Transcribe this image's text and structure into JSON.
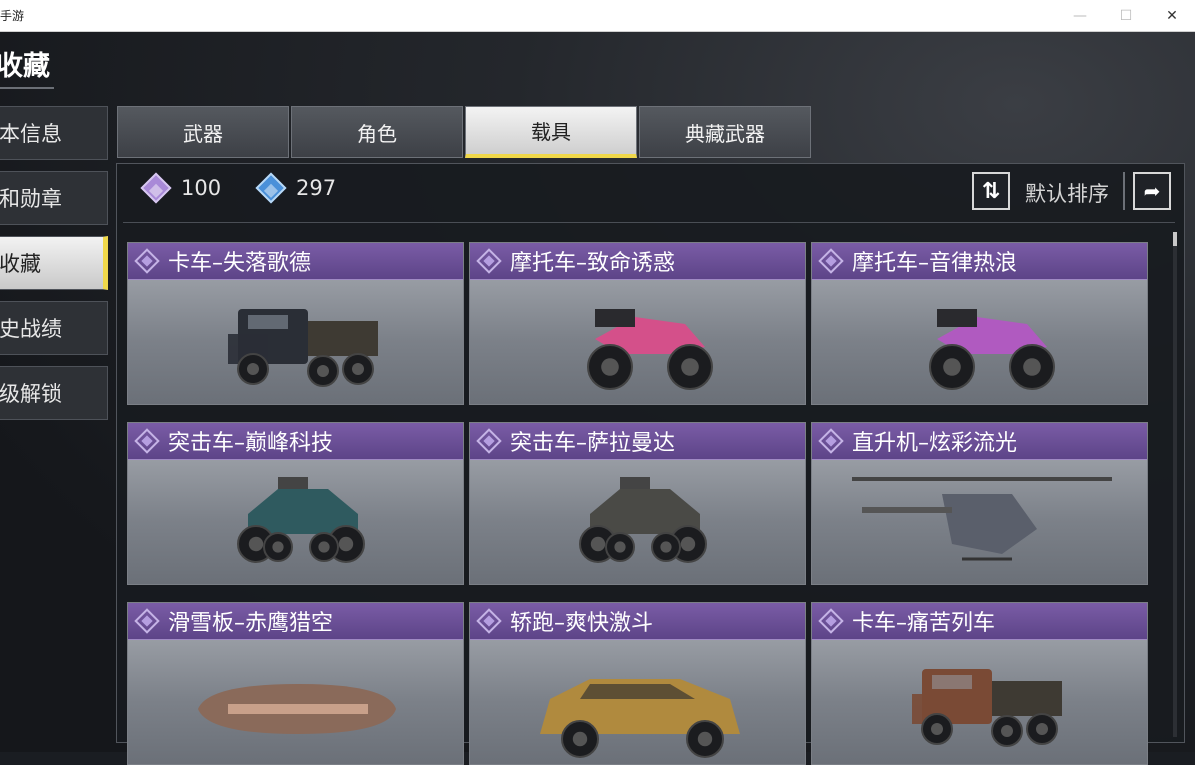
{
  "window": {
    "title": "手游",
    "minimize": "—",
    "maximize": "☐",
    "close": "✕"
  },
  "header": {
    "title": "收藏"
  },
  "sidebar": {
    "items": [
      {
        "label": "基本信息",
        "active": false
      },
      {
        "label": "徽章和勋章",
        "active": false
      },
      {
        "label": "收藏",
        "active": true
      },
      {
        "label": "历史战绩",
        "active": false
      },
      {
        "label": "等级解锁",
        "active": false
      }
    ]
  },
  "tabs": [
    {
      "label": "武器",
      "active": false
    },
    {
      "label": "角色",
      "active": false
    },
    {
      "label": "载具",
      "active": true
    },
    {
      "label": "典藏武器",
      "active": false
    }
  ],
  "currency": {
    "purple": "100",
    "blue": "297"
  },
  "sort": {
    "icon": "swap-vertical-icon",
    "label": "默认排序",
    "share_icon": "share-icon"
  },
  "colors": {
    "accent": "#f0d84a",
    "card_header": "#6a4f96",
    "gem_purple": "#a98ad8",
    "gem_blue": "#4a90d9"
  },
  "cards": [
    {
      "name": "卡车–失落歌德",
      "kind": "truck",
      "tone": "#2a2e36"
    },
    {
      "name": "摩托车–致命诱惑",
      "kind": "moto",
      "tone": "#d4508a"
    },
    {
      "name": "摩托车–音律热浪",
      "kind": "moto",
      "tone": "#b05ac0"
    },
    {
      "name": "突击车–巅峰科技",
      "kind": "buggy",
      "tone": "#2f5a5f"
    },
    {
      "name": "突击车–萨拉曼达",
      "kind": "buggy",
      "tone": "#4a4a46"
    },
    {
      "name": "直升机–炫彩流光",
      "kind": "heli",
      "tone": "#5a5f6b"
    },
    {
      "name": "滑雪板–赤鹰猎空",
      "kind": "board",
      "tone": "#8a6a5a"
    },
    {
      "name": "轿跑–爽快激斗",
      "kind": "car",
      "tone": "#b08a3e"
    },
    {
      "name": "卡车–痛苦列车",
      "kind": "truck2",
      "tone": "#7a4a35"
    }
  ]
}
